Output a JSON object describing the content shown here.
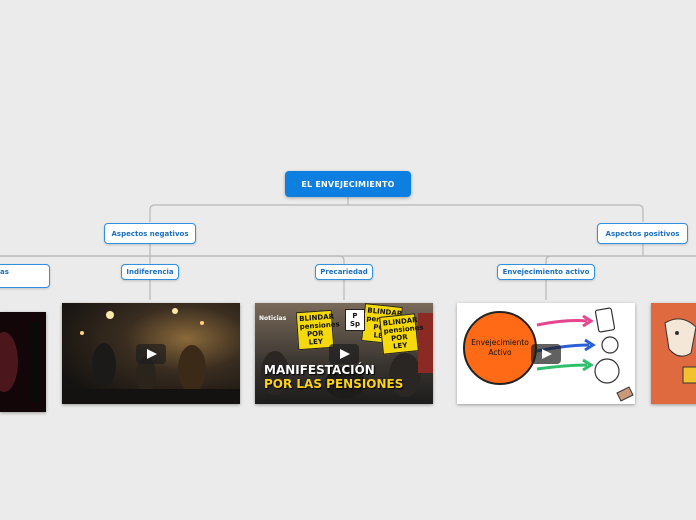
{
  "map": {
    "root": "EL ENVEJECIMIENTO",
    "branches": {
      "negative": "Aspectos negativos",
      "positive": "Aspectos positivos"
    },
    "topics": {
      "partial_left": "nas",
      "indiferencia": "Indiferencia",
      "precariedad": "Precariedad",
      "envejecimiento_activo": "Envejecimiento activo"
    }
  },
  "videos": {
    "protest": {
      "corner_label": "Noticias",
      "signs": [
        "BLINDAR pensiones POR LEY",
        "BLINDAR pensiones POR LEY",
        "BLINDAR pensiones POR LEY",
        "P Sp"
      ],
      "banner_line1": "MANIFESTACIÓN",
      "banner_line2": "POR LAS PENSIONES"
    },
    "active": {
      "circle_text": "Envejecimiento Activo"
    }
  },
  "colors": {
    "background": "#ebebeb",
    "root_fill": "#0d7fe0",
    "node_border": "#2f8fe0",
    "node_text": "#1a6fc0",
    "connector": "#b8b8b8",
    "banner_white": "#ffffff",
    "banner_yellow": "#ffd21a"
  }
}
